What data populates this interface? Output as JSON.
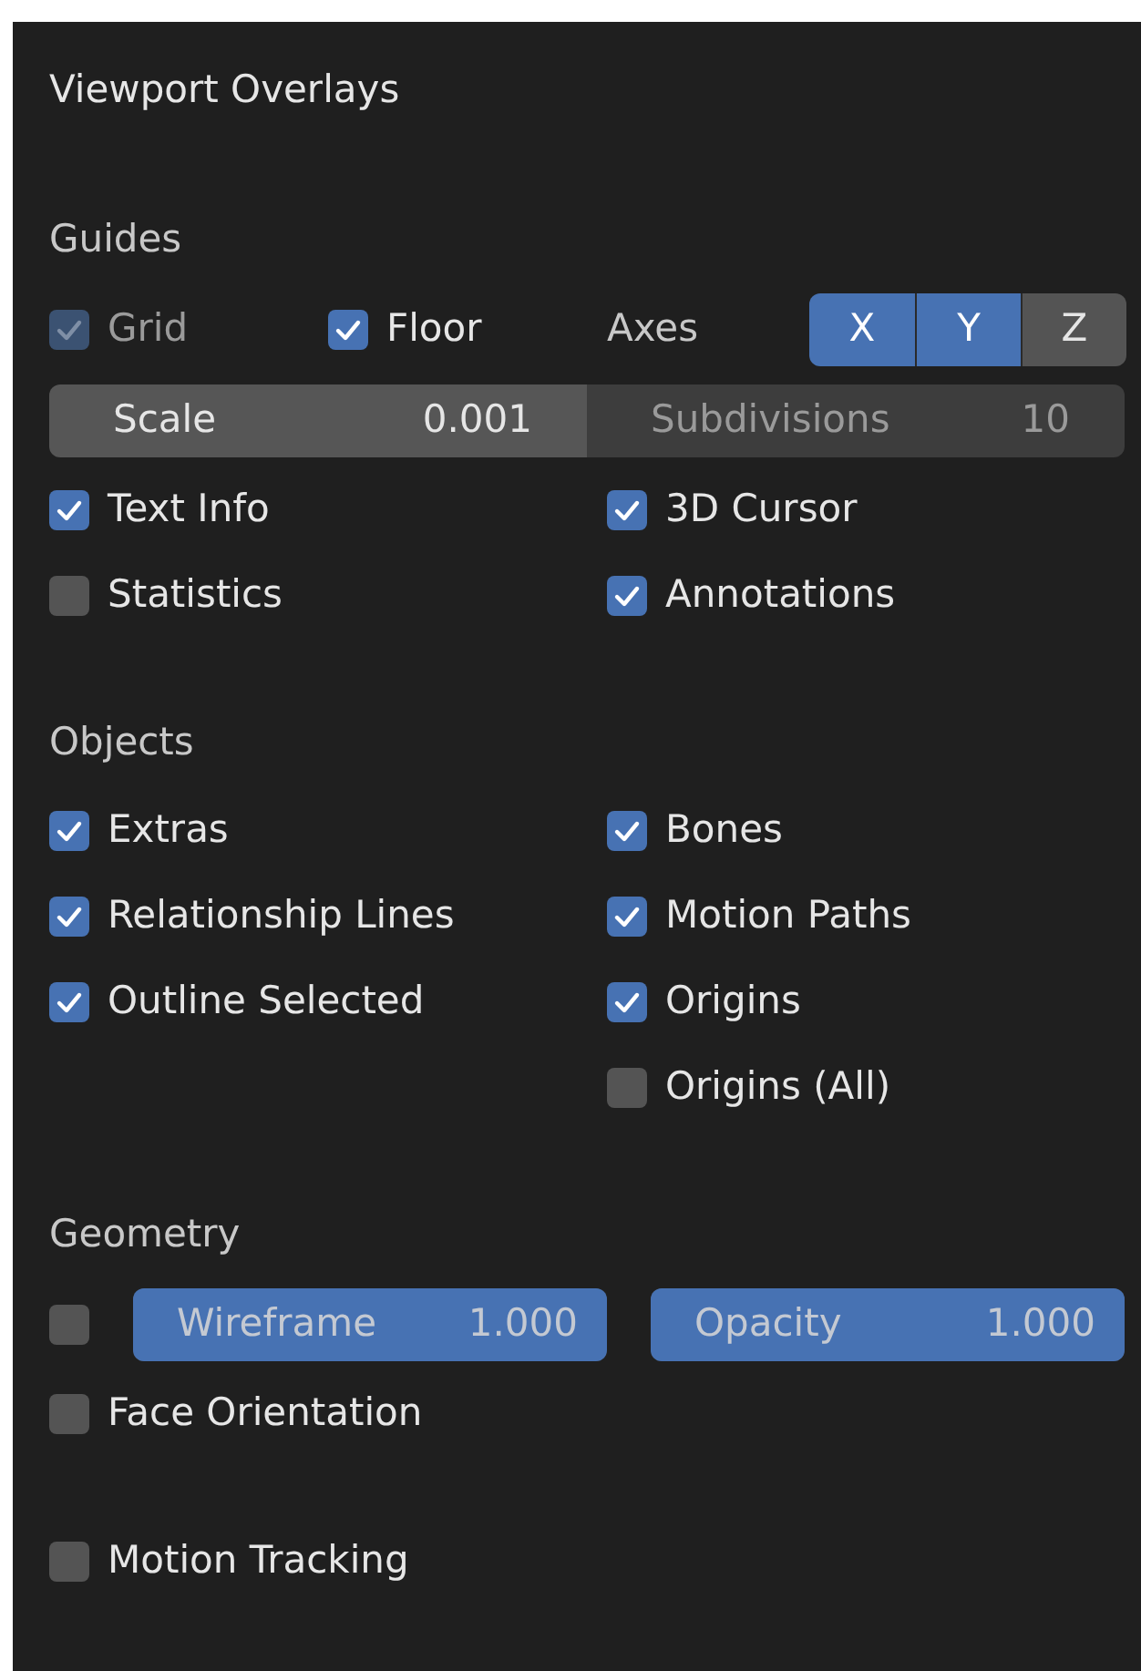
{
  "title": "Viewport Overlays",
  "sections": [
    {
      "heading": "Guides",
      "rows": [
        {
          "kind": "grid",
          "grid": {
            "label": "Grid",
            "checked": true,
            "disabled": true
          },
          "floor": {
            "label": "Floor",
            "checked": true,
            "disabled": false
          },
          "axes_label": "Axes",
          "axes": [
            {
              "label": "X",
              "selected": true
            },
            {
              "label": "Y",
              "selected": true
            },
            {
              "label": "Z",
              "selected": false
            }
          ]
        },
        {
          "kind": "fields",
          "fields": [
            {
              "label": "Scale",
              "value": "0.001",
              "disabled": false
            },
            {
              "label": "Subdivisions",
              "value": "10",
              "disabled": true
            }
          ]
        },
        {
          "kind": "checks",
          "left": {
            "label": "Text Info",
            "checked": true,
            "disabled": false
          },
          "right": {
            "label": "3D Cursor",
            "checked": true,
            "disabled": false
          }
        },
        {
          "kind": "checks",
          "left": {
            "label": "Statistics",
            "checked": false,
            "disabled": false
          },
          "right": {
            "label": "Annotations",
            "checked": true,
            "disabled": false
          }
        }
      ]
    },
    {
      "heading": "Objects",
      "rows": [
        {
          "kind": "checks",
          "left": {
            "label": "Extras",
            "checked": true,
            "disabled": false
          },
          "right": {
            "label": "Bones",
            "checked": true,
            "disabled": false
          }
        },
        {
          "kind": "checks",
          "left": {
            "label": "Relationship Lines",
            "checked": true,
            "disabled": false
          },
          "right": {
            "label": "Motion Paths",
            "checked": true,
            "disabled": false
          }
        },
        {
          "kind": "checks",
          "left": {
            "label": "Outline Selected",
            "checked": true,
            "disabled": false
          },
          "right": {
            "label": "Origins",
            "checked": true,
            "disabled": false
          }
        },
        {
          "kind": "checks",
          "right": {
            "label": "Origins (All)",
            "checked": false,
            "disabled": false
          }
        }
      ]
    },
    {
      "heading": "Geometry",
      "rows": [
        {
          "kind": "sliders",
          "checkbox": {
            "checked": false
          },
          "sliders": [
            {
              "label": "Wireframe",
              "value": "1.000",
              "level": 1
            },
            {
              "label": "Opacity",
              "value": "1.000",
              "level": 1
            }
          ]
        },
        {
          "kind": "checks",
          "left": {
            "label": "Face Orientation",
            "checked": false,
            "disabled": false
          }
        }
      ]
    },
    {
      "rows": [
        {
          "kind": "checks",
          "left": {
            "label": "Motion Tracking",
            "checked": false,
            "disabled": false
          }
        }
      ]
    }
  ]
}
